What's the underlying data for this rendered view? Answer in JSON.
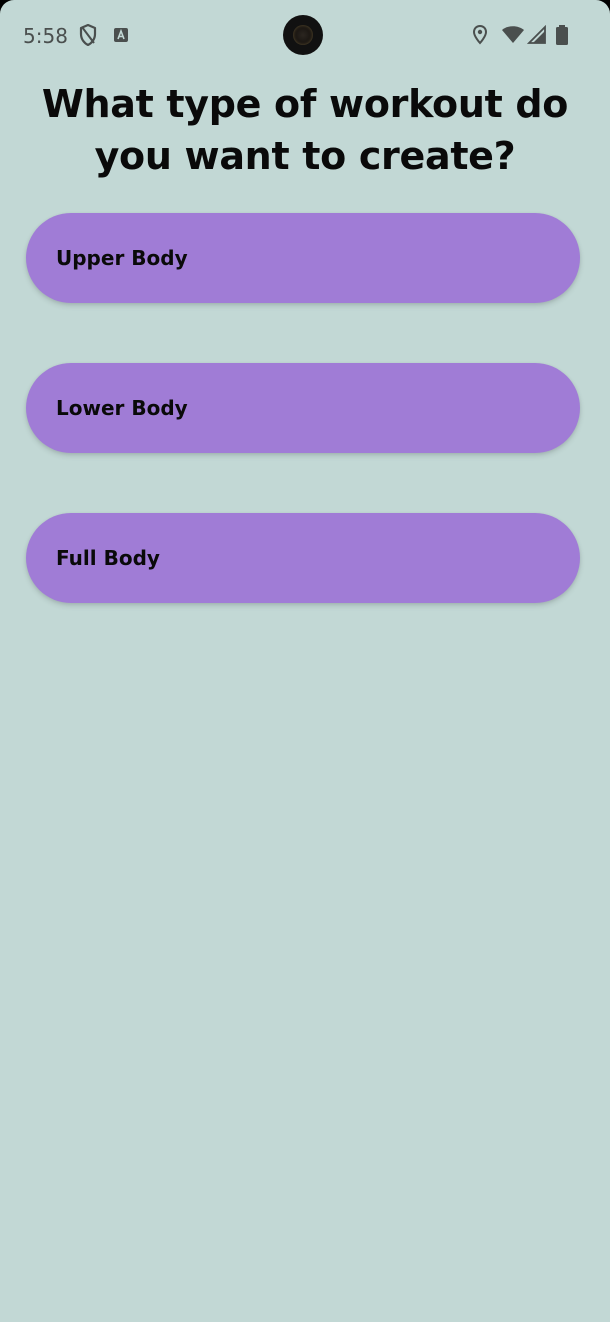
{
  "status_bar": {
    "time": "5:58",
    "left_icons": [
      "shield-icon",
      "text-box-icon"
    ],
    "right_icons": [
      "location-pin-icon",
      "wifi-icon",
      "cell-signal-icon",
      "battery-icon"
    ]
  },
  "page": {
    "title": "What type of workout do you want to create?"
  },
  "options": [
    {
      "label": "Upper Body"
    },
    {
      "label": "Lower Body"
    },
    {
      "label": "Full Body"
    }
  ],
  "colors": {
    "background": "#c2d8d5",
    "button": "#a07cd6",
    "text": "#0a0a0a"
  }
}
